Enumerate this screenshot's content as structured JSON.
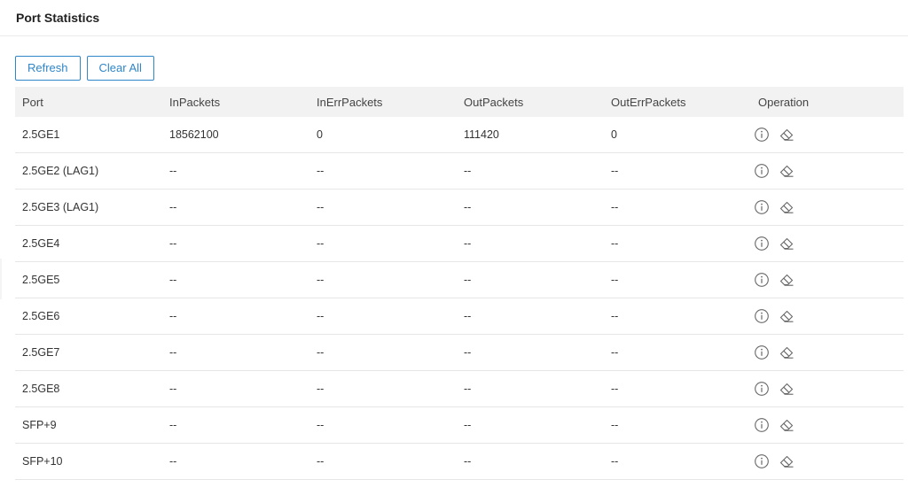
{
  "page": {
    "title": "Port Statistics"
  },
  "toolbar": {
    "refresh_label": "Refresh",
    "clear_all_label": "Clear All"
  },
  "table": {
    "headers": [
      "Port",
      "InPackets",
      "InErrPackets",
      "OutPackets",
      "OutErrPackets",
      "Operation"
    ],
    "rows": [
      [
        "2.5GE1",
        "18562100",
        "0",
        "111420",
        "0"
      ],
      [
        "2.5GE2 (LAG1)",
        "--",
        "--",
        "--",
        "--"
      ],
      [
        "2.5GE3 (LAG1)",
        "--",
        "--",
        "--",
        "--"
      ],
      [
        "2.5GE4",
        "--",
        "--",
        "--",
        "--"
      ],
      [
        "2.5GE5",
        "--",
        "--",
        "--",
        "--"
      ],
      [
        "2.5GE6",
        "--",
        "--",
        "--",
        "--"
      ],
      [
        "2.5GE7",
        "--",
        "--",
        "--",
        "--"
      ],
      [
        "2.5GE8",
        "--",
        "--",
        "--",
        "--"
      ],
      [
        "SFP+9",
        "--",
        "--",
        "--",
        "--"
      ],
      [
        "SFP+10",
        "--",
        "--",
        "--",
        "--"
      ]
    ],
    "operation_icons": [
      "info-icon",
      "eraser-icon"
    ]
  },
  "colors": {
    "accent": "#2f86c9",
    "header_bg": "#f2f2f2",
    "icon": "#666666"
  }
}
